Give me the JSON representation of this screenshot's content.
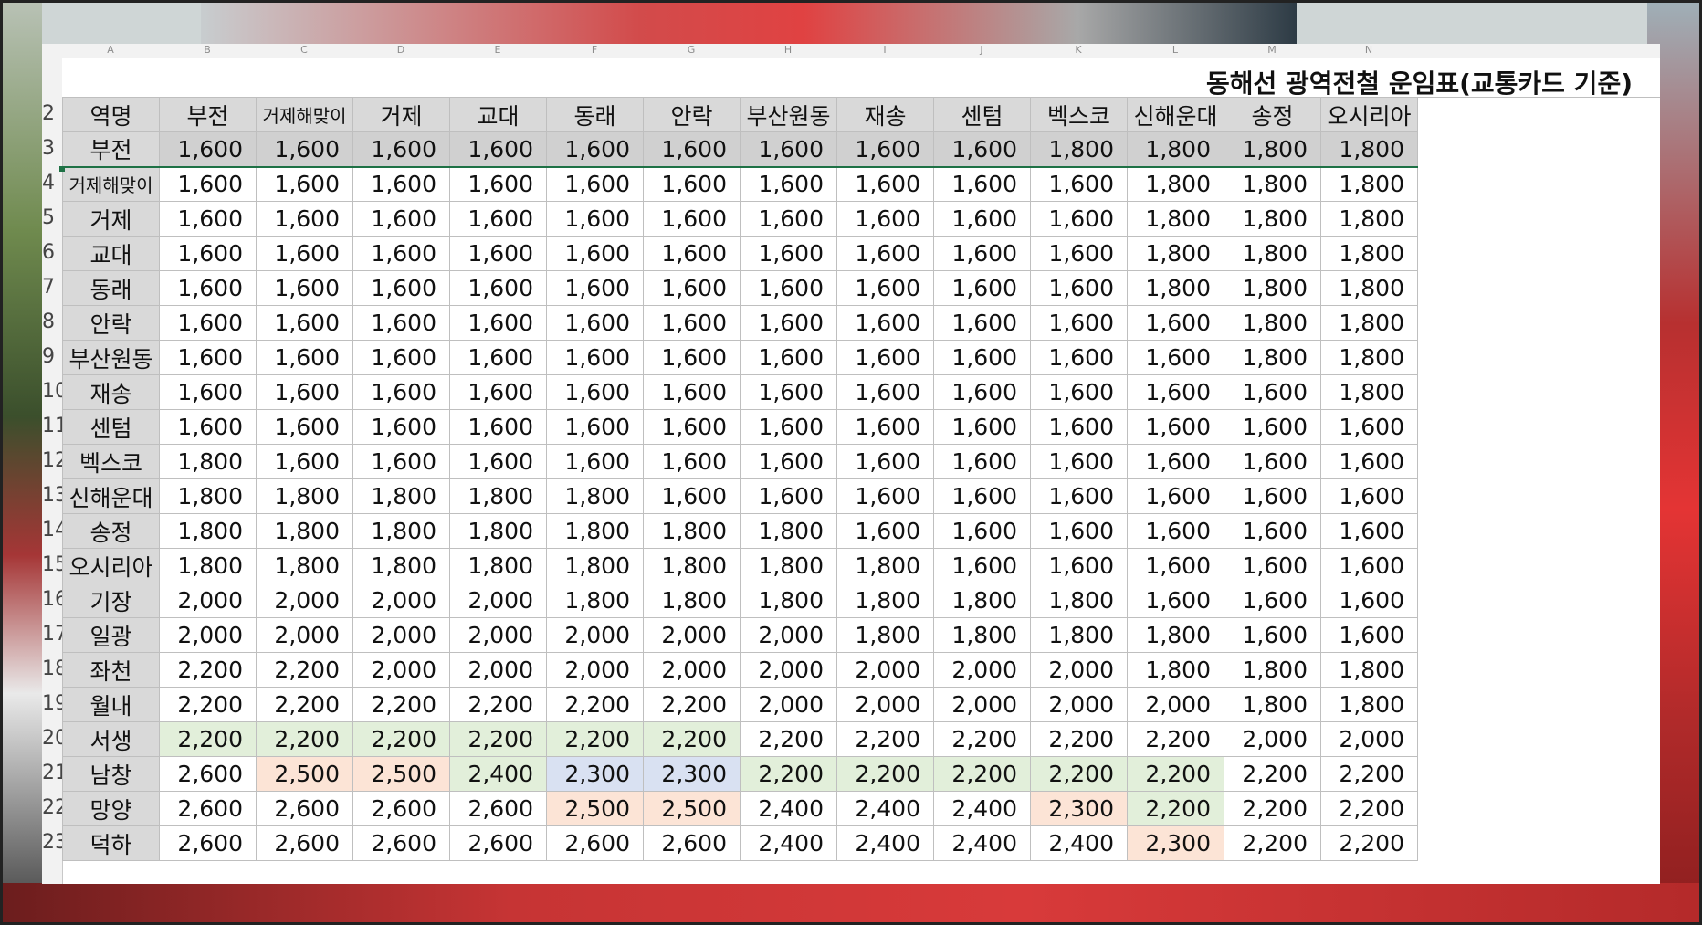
{
  "title": "동해선 광역전철 운임표(교통카드 기준)",
  "column_letters": [
    "A",
    "B",
    "C",
    "D",
    "E",
    "F",
    "G",
    "H",
    "I",
    "J",
    "K",
    "L",
    "M",
    "N"
  ],
  "row_numbers": [
    "2",
    "3",
    "4",
    "5",
    "6",
    "7",
    "8",
    "9",
    "10",
    "11",
    "12",
    "13",
    "14",
    "15",
    "16",
    "17",
    "18",
    "19",
    "20",
    "21",
    "22",
    "23"
  ],
  "header_label": "역명",
  "columns": [
    "부전",
    "거제해맞이",
    "거제",
    "교대",
    "동래",
    "안락",
    "부산원동",
    "재송",
    "센텀",
    "벡스코",
    "신해운대",
    "송정",
    "오시리아"
  ],
  "rows": [
    {
      "station": "부전",
      "fares": [
        "1,600",
        "1,600",
        "1,600",
        "1,600",
        "1,600",
        "1,600",
        "1,600",
        "1,600",
        "1,600",
        "1,800",
        "1,800",
        "1,800",
        "1,800"
      ],
      "hl": [
        "",
        "",
        "",
        "",
        "",
        "",
        "",
        "",
        "",
        "",
        "",
        "",
        ""
      ]
    },
    {
      "station": "거제해맞이",
      "fares": [
        "1,600",
        "1,600",
        "1,600",
        "1,600",
        "1,600",
        "1,600",
        "1,600",
        "1,600",
        "1,600",
        "1,600",
        "1,800",
        "1,800",
        "1,800"
      ],
      "hl": [
        "",
        "",
        "",
        "",
        "",
        "",
        "",
        "",
        "",
        "",
        "",
        "",
        ""
      ]
    },
    {
      "station": "거제",
      "fares": [
        "1,600",
        "1,600",
        "1,600",
        "1,600",
        "1,600",
        "1,600",
        "1,600",
        "1,600",
        "1,600",
        "1,600",
        "1,800",
        "1,800",
        "1,800"
      ],
      "hl": [
        "",
        "",
        "",
        "",
        "",
        "",
        "",
        "",
        "",
        "",
        "",
        "",
        ""
      ]
    },
    {
      "station": "교대",
      "fares": [
        "1,600",
        "1,600",
        "1,600",
        "1,600",
        "1,600",
        "1,600",
        "1,600",
        "1,600",
        "1,600",
        "1,600",
        "1,800",
        "1,800",
        "1,800"
      ],
      "hl": [
        "",
        "",
        "",
        "",
        "",
        "",
        "",
        "",
        "",
        "",
        "",
        "",
        ""
      ]
    },
    {
      "station": "동래",
      "fares": [
        "1,600",
        "1,600",
        "1,600",
        "1,600",
        "1,600",
        "1,600",
        "1,600",
        "1,600",
        "1,600",
        "1,600",
        "1,800",
        "1,800",
        "1,800"
      ],
      "hl": [
        "",
        "",
        "",
        "",
        "",
        "",
        "",
        "",
        "",
        "",
        "",
        "",
        ""
      ]
    },
    {
      "station": "안락",
      "fares": [
        "1,600",
        "1,600",
        "1,600",
        "1,600",
        "1,600",
        "1,600",
        "1,600",
        "1,600",
        "1,600",
        "1,600",
        "1,600",
        "1,800",
        "1,800"
      ],
      "hl": [
        "",
        "",
        "",
        "",
        "",
        "",
        "",
        "",
        "",
        "",
        "",
        "",
        ""
      ]
    },
    {
      "station": "부산원동",
      "fares": [
        "1,600",
        "1,600",
        "1,600",
        "1,600",
        "1,600",
        "1,600",
        "1,600",
        "1,600",
        "1,600",
        "1,600",
        "1,600",
        "1,800",
        "1,800"
      ],
      "hl": [
        "",
        "",
        "",
        "",
        "",
        "",
        "",
        "",
        "",
        "",
        "",
        "",
        ""
      ]
    },
    {
      "station": "재송",
      "fares": [
        "1,600",
        "1,600",
        "1,600",
        "1,600",
        "1,600",
        "1,600",
        "1,600",
        "1,600",
        "1,600",
        "1,600",
        "1,600",
        "1,600",
        "1,800"
      ],
      "hl": [
        "",
        "",
        "",
        "",
        "",
        "",
        "",
        "",
        "",
        "",
        "",
        "",
        ""
      ]
    },
    {
      "station": "센텀",
      "fares": [
        "1,600",
        "1,600",
        "1,600",
        "1,600",
        "1,600",
        "1,600",
        "1,600",
        "1,600",
        "1,600",
        "1,600",
        "1,600",
        "1,600",
        "1,600"
      ],
      "hl": [
        "",
        "",
        "",
        "",
        "",
        "",
        "",
        "",
        "",
        "",
        "",
        "",
        ""
      ]
    },
    {
      "station": "벡스코",
      "fares": [
        "1,800",
        "1,600",
        "1,600",
        "1,600",
        "1,600",
        "1,600",
        "1,600",
        "1,600",
        "1,600",
        "1,600",
        "1,600",
        "1,600",
        "1,600"
      ],
      "hl": [
        "",
        "",
        "",
        "",
        "",
        "",
        "",
        "",
        "",
        "",
        "",
        "",
        ""
      ]
    },
    {
      "station": "신해운대",
      "fares": [
        "1,800",
        "1,800",
        "1,800",
        "1,800",
        "1,800",
        "1,600",
        "1,600",
        "1,600",
        "1,600",
        "1,600",
        "1,600",
        "1,600",
        "1,600"
      ],
      "hl": [
        "",
        "",
        "",
        "",
        "",
        "",
        "",
        "",
        "",
        "",
        "",
        "",
        ""
      ]
    },
    {
      "station": "송정",
      "fares": [
        "1,800",
        "1,800",
        "1,800",
        "1,800",
        "1,800",
        "1,800",
        "1,800",
        "1,600",
        "1,600",
        "1,600",
        "1,600",
        "1,600",
        "1,600"
      ],
      "hl": [
        "",
        "",
        "",
        "",
        "",
        "",
        "",
        "",
        "",
        "",
        "",
        "",
        ""
      ]
    },
    {
      "station": "오시리아",
      "fares": [
        "1,800",
        "1,800",
        "1,800",
        "1,800",
        "1,800",
        "1,800",
        "1,800",
        "1,800",
        "1,600",
        "1,600",
        "1,600",
        "1,600",
        "1,600"
      ],
      "hl": [
        "",
        "",
        "",
        "",
        "",
        "",
        "",
        "",
        "",
        "",
        "",
        "",
        ""
      ]
    },
    {
      "station": "기장",
      "fares": [
        "2,000",
        "2,000",
        "2,000",
        "2,000",
        "1,800",
        "1,800",
        "1,800",
        "1,800",
        "1,800",
        "1,800",
        "1,600",
        "1,600",
        "1,600"
      ],
      "hl": [
        "",
        "",
        "",
        "",
        "",
        "",
        "",
        "",
        "",
        "",
        "",
        "",
        ""
      ]
    },
    {
      "station": "일광",
      "fares": [
        "2,000",
        "2,000",
        "2,000",
        "2,000",
        "2,000",
        "2,000",
        "2,000",
        "1,800",
        "1,800",
        "1,800",
        "1,800",
        "1,600",
        "1,600"
      ],
      "hl": [
        "",
        "",
        "",
        "",
        "",
        "",
        "",
        "",
        "",
        "",
        "",
        "",
        ""
      ]
    },
    {
      "station": "좌천",
      "fares": [
        "2,200",
        "2,200",
        "2,000",
        "2,000",
        "2,000",
        "2,000",
        "2,000",
        "2,000",
        "2,000",
        "2,000",
        "1,800",
        "1,800",
        "1,800"
      ],
      "hl": [
        "",
        "",
        "",
        "",
        "",
        "",
        "",
        "",
        "",
        "",
        "",
        "",
        ""
      ]
    },
    {
      "station": "월내",
      "fares": [
        "2,200",
        "2,200",
        "2,200",
        "2,200",
        "2,200",
        "2,200",
        "2,000",
        "2,000",
        "2,000",
        "2,000",
        "2,000",
        "1,800",
        "1,800"
      ],
      "hl": [
        "",
        "",
        "",
        "",
        "",
        "",
        "",
        "",
        "",
        "",
        "",
        "",
        ""
      ]
    },
    {
      "station": "서생",
      "fares": [
        "2,200",
        "2,200",
        "2,200",
        "2,200",
        "2,200",
        "2,200",
        "2,200",
        "2,200",
        "2,200",
        "2,200",
        "2,200",
        "2,000",
        "2,000"
      ],
      "hl": [
        "g",
        "g",
        "g",
        "g",
        "g",
        "g",
        "",
        "",
        "",
        "",
        "",
        "",
        ""
      ]
    },
    {
      "station": "남창",
      "fares": [
        "2,600",
        "2,500",
        "2,500",
        "2,400",
        "2,300",
        "2,300",
        "2,200",
        "2,200",
        "2,200",
        "2,200",
        "2,200",
        "2,200",
        "2,200"
      ],
      "hl": [
        "",
        "o",
        "o",
        "g",
        "b",
        "b",
        "g",
        "g",
        "g",
        "g",
        "g",
        "",
        ""
      ]
    },
    {
      "station": "망양",
      "fares": [
        "2,600",
        "2,600",
        "2,600",
        "2,600",
        "2,500",
        "2,500",
        "2,400",
        "2,400",
        "2,400",
        "2,300",
        "2,200",
        "2,200",
        "2,200"
      ],
      "hl": [
        "",
        "",
        "",
        "",
        "o",
        "o",
        "",
        "",
        "",
        "o",
        "g",
        "",
        ""
      ]
    },
    {
      "station": "덕하",
      "fares": [
        "2,600",
        "2,600",
        "2,600",
        "2,600",
        "2,600",
        "2,600",
        "2,400",
        "2,400",
        "2,400",
        "2,400",
        "2,300",
        "2,200",
        "2,200"
      ],
      "hl": [
        "",
        "",
        "",
        "",
        "",
        "",
        "",
        "",
        "",
        "",
        "o",
        "",
        ""
      ]
    }
  ]
}
